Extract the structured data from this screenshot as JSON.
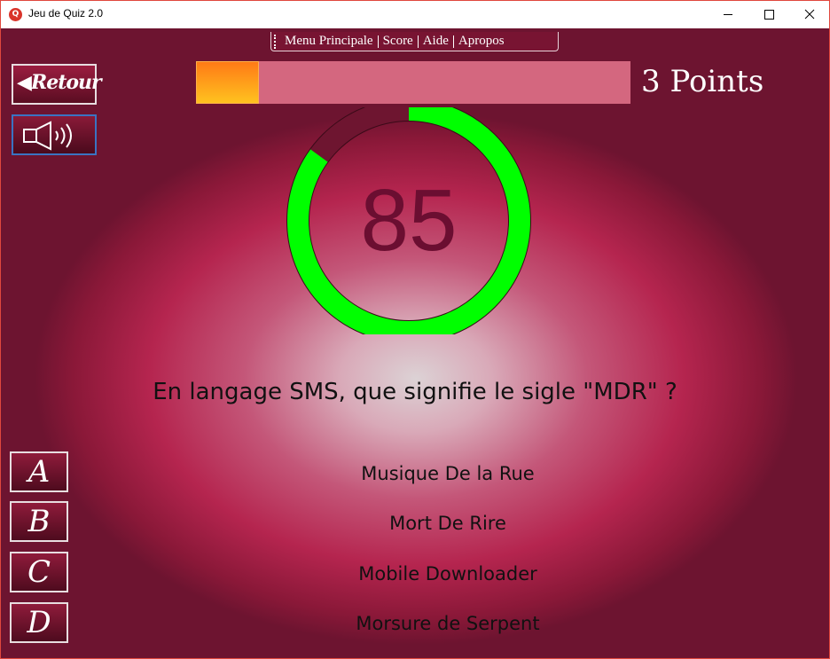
{
  "window": {
    "title": "Jeu de Quiz 2.0",
    "app_icon_letter": "Q"
  },
  "menu": {
    "items": [
      "Menu Principale",
      "Score",
      "Aide",
      "Apropos"
    ]
  },
  "nav": {
    "back_label": "◀Retour",
    "sound_icon": "speaker-icon"
  },
  "progress": {
    "fraction": 0.145,
    "points_label": "3 Points"
  },
  "timer": {
    "value": "85",
    "fraction_elapsed": 0.15,
    "colors": {
      "remaining": "#00ff00",
      "elapsed": "#6e1530"
    }
  },
  "question": {
    "text": "En langage SMS, que signifie le sigle \"MDR\" ?"
  },
  "answers": [
    {
      "letter": "A",
      "text": "Musique De la Rue"
    },
    {
      "letter": "B",
      "text": "Mort De Rire"
    },
    {
      "letter": "C",
      "text": "Mobile Downloader"
    },
    {
      "letter": "D",
      "text": "Morsure de Serpent"
    }
  ]
}
